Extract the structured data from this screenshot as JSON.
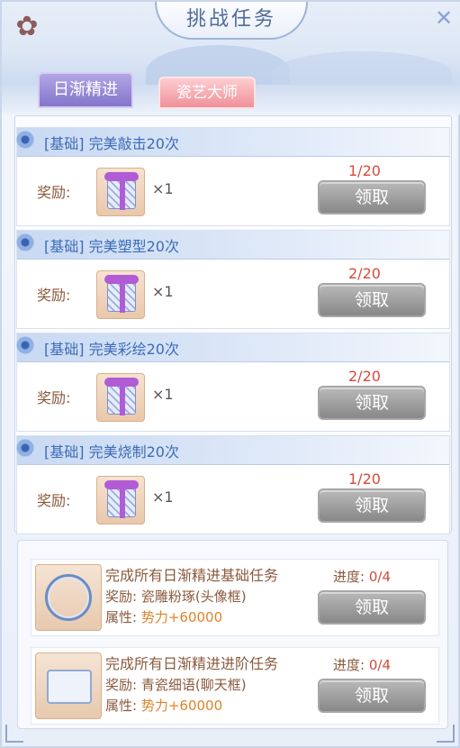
{
  "header": {
    "title": "挑战任务"
  },
  "tabs": [
    {
      "label": "日渐精进",
      "active": true
    },
    {
      "label": "瓷艺大师",
      "active": false
    }
  ],
  "tasks": [
    {
      "tag": "[基础]",
      "name": "完美敲击20次",
      "reward_label": "奖励:",
      "qty": "×1",
      "progress": "1/20",
      "button": "领取"
    },
    {
      "tag": "[基础]",
      "name": "完美塑型20次",
      "reward_label": "奖励:",
      "qty": "×1",
      "progress": "2/20",
      "button": "领取"
    },
    {
      "tag": "[基础]",
      "name": "完美彩绘20次",
      "reward_label": "奖励:",
      "qty": "×1",
      "progress": "2/20",
      "button": "领取"
    },
    {
      "tag": "[基础]",
      "name": "完美烧制20次",
      "reward_label": "奖励:",
      "qty": "×1",
      "progress": "1/20",
      "button": "领取"
    }
  ],
  "big_tasks": [
    {
      "title": "完成所有日渐精进基础任务",
      "reward_prefix": "奖励:",
      "reward": "瓷雕粉琢(头像框)",
      "attr_prefix": "属性:",
      "attr": "势力+60000",
      "progress_label": "进度:",
      "progress_value": "0/4",
      "button": "领取",
      "icon": "avatar-frame-icon"
    },
    {
      "title": "完成所有日渐精进进阶任务",
      "reward_prefix": "奖励:",
      "reward": "青瓷细语(聊天框)",
      "attr_prefix": "属性:",
      "attr": "势力+60000",
      "progress_label": "进度:",
      "progress_value": "0/4",
      "button": "领取",
      "icon": "chat-frame-icon"
    }
  ],
  "colors": {
    "accent_blue": "#3d6cb7",
    "progress_red": "#d44a3a",
    "tab_active": "#8172c9",
    "tab_inactive": "#ef8d96",
    "button_gray": "#888888"
  }
}
